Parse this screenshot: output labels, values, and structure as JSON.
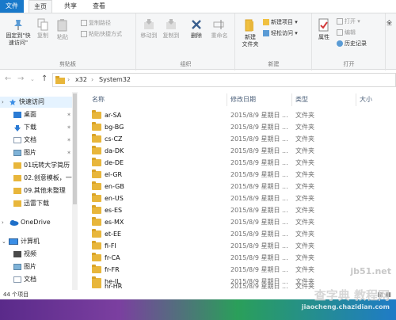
{
  "ribbon_tabs": [
    "文件",
    "主页",
    "共享",
    "查看"
  ],
  "clipboard": {
    "pin_label_1": "固定到\"快",
    "pin_label_2": "速访问\"",
    "copy": "复制",
    "paste": "粘贴",
    "copy_path": "复制路径",
    "paste_shortcut": "粘贴快捷方式",
    "group": "剪贴板"
  },
  "organize": {
    "move_to": "移动到",
    "copy_to": "复制到",
    "delete": "删除",
    "rename": "重命名",
    "group": "组织"
  },
  "new": {
    "new_folder_1": "新建",
    "new_folder_2": "文件夹",
    "new_item": "新建项目 ▾",
    "easy_access": "轻松访问 ▾",
    "group": "新建"
  },
  "open": {
    "properties": "属性",
    "open": "打开 ▾",
    "edit": "编辑",
    "history": "历史记录",
    "group": "打开"
  },
  "select_label": "全",
  "address": {
    "crumbs": [
      "x32",
      "System32"
    ]
  },
  "nav_pane": {
    "items": [
      {
        "label": "快速访问",
        "pin": ""
      },
      {
        "label": "桌面",
        "pin": "✶"
      },
      {
        "label": "下载",
        "pin": "✶"
      },
      {
        "label": "文档",
        "pin": "✶"
      },
      {
        "label": "图片",
        "pin": "✶"
      },
      {
        "label": "01玩转大学简历",
        "pin": ""
      },
      {
        "label": "02.创意模板，一",
        "pin": ""
      },
      {
        "label": "09.其他未整理",
        "pin": ""
      },
      {
        "label": "迅雷下载",
        "pin": ""
      },
      {
        "label": "OneDrive",
        "pin": ""
      },
      {
        "label": "计算机",
        "pin": ""
      },
      {
        "label": "视频",
        "pin": ""
      },
      {
        "label": "图片",
        "pin": ""
      },
      {
        "label": "文档",
        "pin": ""
      }
    ]
  },
  "columns": {
    "name": "名称",
    "date": "修改日期",
    "type": "类型",
    "size": "大小"
  },
  "files": [
    {
      "name": "ar-SA",
      "date": "2015/8/9 星期日 ...",
      "type": "文件夹"
    },
    {
      "name": "bg-BG",
      "date": "2015/8/9 星期日 ...",
      "type": "文件夹"
    },
    {
      "name": "cs-CZ",
      "date": "2015/8/9 星期日 ...",
      "type": "文件夹"
    },
    {
      "name": "da-DK",
      "date": "2015/8/9 星期日 ...",
      "type": "文件夹"
    },
    {
      "name": "de-DE",
      "date": "2015/8/9 星期日 ...",
      "type": "文件夹"
    },
    {
      "name": "el-GR",
      "date": "2015/8/9 星期日 ...",
      "type": "文件夹"
    },
    {
      "name": "en-GB",
      "date": "2015/8/9 星期日 ...",
      "type": "文件夹"
    },
    {
      "name": "en-US",
      "date": "2015/8/9 星期日 ...",
      "type": "文件夹"
    },
    {
      "name": "es-ES",
      "date": "2015/8/9 星期日 ...",
      "type": "文件夹"
    },
    {
      "name": "es-MX",
      "date": "2015/8/9 星期日 ...",
      "type": "文件夹"
    },
    {
      "name": "et-EE",
      "date": "2015/8/9 星期日 ...",
      "type": "文件夹"
    },
    {
      "name": "fi-FI",
      "date": "2015/8/9 星期日 ...",
      "type": "文件夹"
    },
    {
      "name": "fr-CA",
      "date": "2015/8/9 星期日 ...",
      "type": "文件夹"
    },
    {
      "name": "fr-FR",
      "date": "2015/8/9 星期日 ...",
      "type": "文件夹"
    },
    {
      "name": "he-IL",
      "date": "2015/8/9 星期日 ...",
      "type": "文件夹"
    },
    {
      "name": "hr-HR",
      "date": "2015/8/9 星期日 ...",
      "type": "文件夹"
    }
  ],
  "status": {
    "count": "44 个项目"
  },
  "watermark": {
    "site": "jb51.net",
    "title": "查字典 教程网",
    "url": "jiaocheng.chazidian.com"
  },
  "colors": {
    "file_tab": "#1979ca",
    "folder": "#e8b63b",
    "header_text": "#4c607a"
  }
}
